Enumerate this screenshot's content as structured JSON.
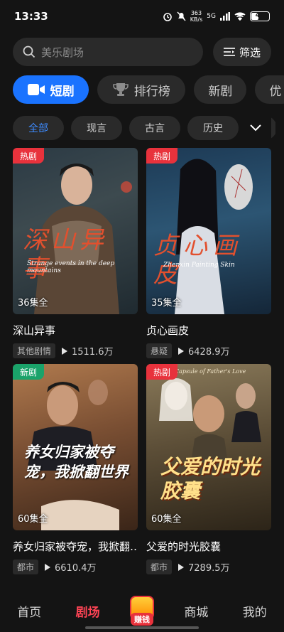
{
  "status": {
    "time": "13:33",
    "speed_value": "363",
    "speed_unit": "KB/s",
    "network": "5G",
    "battery": "42",
    "battery_level": 0.42
  },
  "search": {
    "placeholder": "美乐剧场",
    "filter_label": "筛选"
  },
  "main_tabs": [
    {
      "label": "短剧",
      "active": true,
      "icon": "video-camera-icon"
    },
    {
      "label": "排行榜",
      "icon": "trophy-icon"
    },
    {
      "label": "新剧"
    },
    {
      "label": "优"
    }
  ],
  "sub_tabs": [
    {
      "label": "全部",
      "active": true
    },
    {
      "label": "现言"
    },
    {
      "label": "古言"
    },
    {
      "label": "历史"
    },
    {
      "label": ""
    }
  ],
  "cards": [
    {
      "badge": "热剧",
      "episodes": "36集全",
      "title": "深山异事",
      "tag": "其他剧情",
      "views": "1511.6万",
      "art_text": "深山异事",
      "art_sub": "Strange events in the deep mountains"
    },
    {
      "badge": "热剧",
      "episodes": "35集全",
      "title": "贞心画皮",
      "tag": "悬疑",
      "views": "6428.9万",
      "art_text": "贞心画皮",
      "art_sub": "Zhenxin Painting Skin"
    },
    {
      "badge": "新剧",
      "episodes": "60集全",
      "title": "养女归家被夺宠，我掀翻…",
      "tag": "都市",
      "views": "6610.4万",
      "art_text": "养女归家被夺宠，我掀翻世界",
      "art_sub": ""
    },
    {
      "badge": "热剧",
      "episodes": "60集全",
      "title": "父爱的时光胶囊",
      "tag": "都市",
      "views": "7289.5万",
      "art_text": "父爱的时光胶囊",
      "art_sub": "Capsule of Father's Love"
    }
  ],
  "bottom_nav": [
    {
      "label": "首页"
    },
    {
      "label": "剧场",
      "active": true
    },
    {
      "label": "赚钱",
      "icon": "earn-money-icon"
    },
    {
      "label": "商城"
    },
    {
      "label": "我的"
    }
  ]
}
